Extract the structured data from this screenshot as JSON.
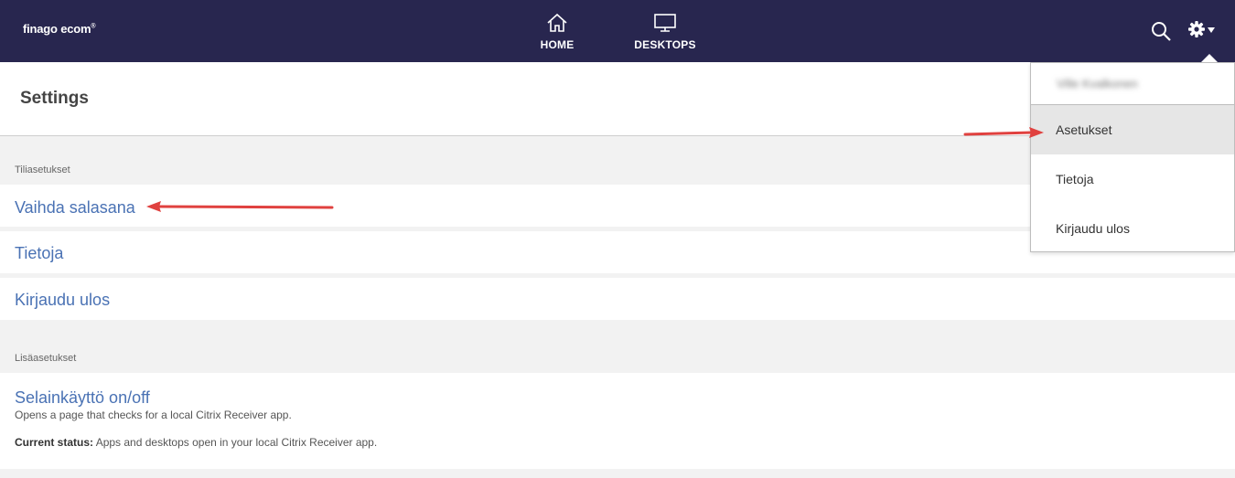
{
  "topbar": {
    "logo": "finago ecom",
    "logo_sup": "®",
    "nav": [
      {
        "label": "HOME",
        "icon": "home-icon"
      },
      {
        "label": "DESKTOPS",
        "icon": "monitor-icon"
      }
    ],
    "search_icon": "search-icon",
    "gear_icon": "gear-icon"
  },
  "header": {
    "title": "Settings"
  },
  "account_section": {
    "label": "Tiliasetukset",
    "items": [
      {
        "label": "Vaihda salasana"
      },
      {
        "label": "Tietoja"
      },
      {
        "label": "Kirjaudu ulos"
      }
    ]
  },
  "extra_section": {
    "label": "Lisäasetukset",
    "item": {
      "label": "Selainkäyttö on/off",
      "description": "Opens a page that checks for a local Citrix Receiver app.",
      "status_label": "Current status:",
      "status_text": " Apps and desktops open in your local Citrix Receiver app."
    }
  },
  "dropdown": {
    "user_name": "Ville Kvalkonen",
    "items": [
      {
        "label": "Asetukset",
        "active": true
      },
      {
        "label": "Tietoja",
        "active": false
      },
      {
        "label": "Kirjaudu ulos",
        "active": false
      }
    ]
  },
  "colors": {
    "topbar": "#28264f",
    "link": "#4a72b4",
    "annotation_arrow": "#e0413f"
  }
}
